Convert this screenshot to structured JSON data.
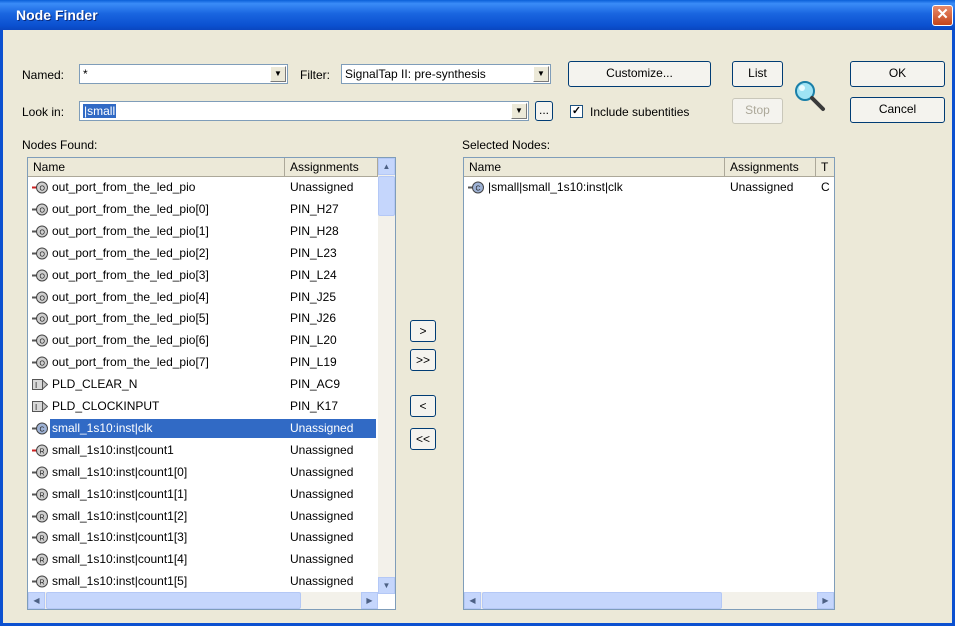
{
  "window": {
    "title": "Node Finder",
    "close_glyph": "✕"
  },
  "named": {
    "label": "Named:",
    "value": "*"
  },
  "filter": {
    "label": "Filter:",
    "value": "SignalTap II: pre-synthesis"
  },
  "look_in": {
    "label": "Look in:",
    "value": "|small",
    "browse": "..."
  },
  "include_subentities": {
    "label": "Include subentities",
    "checked": true
  },
  "buttons": {
    "customize": "Customize...",
    "list": "List",
    "stop": "Stop",
    "ok": "OK",
    "cancel": "Cancel"
  },
  "nodes_found": {
    "label": "Nodes Found:",
    "columns": [
      "Name",
      "Assignments"
    ],
    "rows": [
      {
        "name": "out_port_from_the_led_pio",
        "assignment": "Unassigned",
        "icon": "output-bus-icon"
      },
      {
        "name": "out_port_from_the_led_pio[0]",
        "assignment": "PIN_H27",
        "icon": "output-pin-icon"
      },
      {
        "name": "out_port_from_the_led_pio[1]",
        "assignment": "PIN_H28",
        "icon": "output-pin-icon"
      },
      {
        "name": "out_port_from_the_led_pio[2]",
        "assignment": "PIN_L23",
        "icon": "output-pin-icon"
      },
      {
        "name": "out_port_from_the_led_pio[3]",
        "assignment": "PIN_L24",
        "icon": "output-pin-icon"
      },
      {
        "name": "out_port_from_the_led_pio[4]",
        "assignment": "PIN_J25",
        "icon": "output-pin-icon"
      },
      {
        "name": "out_port_from_the_led_pio[5]",
        "assignment": "PIN_J26",
        "icon": "output-pin-icon"
      },
      {
        "name": "out_port_from_the_led_pio[6]",
        "assignment": "PIN_L20",
        "icon": "output-pin-icon"
      },
      {
        "name": "out_port_from_the_led_pio[7]",
        "assignment": "PIN_L19",
        "icon": "output-pin-icon"
      },
      {
        "name": "PLD_CLEAR_N",
        "assignment": "PIN_AC9",
        "icon": "input-pin-icon"
      },
      {
        "name": "PLD_CLOCKINPUT",
        "assignment": "PIN_K17",
        "icon": "input-pin-icon"
      },
      {
        "name": "small_1s10:inst|clk",
        "assignment": "Unassigned",
        "icon": "combinational-node-icon",
        "selected": true
      },
      {
        "name": "small_1s10:inst|count1",
        "assignment": "Unassigned",
        "icon": "register-bus-icon"
      },
      {
        "name": "small_1s10:inst|count1[0]",
        "assignment": "Unassigned",
        "icon": "register-icon"
      },
      {
        "name": "small_1s10:inst|count1[1]",
        "assignment": "Unassigned",
        "icon": "register-icon"
      },
      {
        "name": "small_1s10:inst|count1[2]",
        "assignment": "Unassigned",
        "icon": "register-icon"
      },
      {
        "name": "small_1s10:inst|count1[3]",
        "assignment": "Unassigned",
        "icon": "register-icon"
      },
      {
        "name": "small_1s10:inst|count1[4]",
        "assignment": "Unassigned",
        "icon": "register-icon"
      },
      {
        "name": "small_1s10:inst|count1[5]",
        "assignment": "Unassigned",
        "icon": "register-icon"
      }
    ]
  },
  "selected_nodes": {
    "label": "Selected Nodes:",
    "columns": [
      "Name",
      "Assignments",
      "T"
    ],
    "rows": [
      {
        "name": "|small|small_1s10:inst|clk",
        "assignment": "Unassigned",
        "type": "C",
        "icon": "combinational-node-icon"
      }
    ]
  },
  "move_buttons": [
    ">",
    ">>",
    "<",
    "<<"
  ],
  "colors": {
    "selection": "#316ac5",
    "titlebar": "#0b50d0",
    "dialog_bg": "#ece9d8"
  }
}
